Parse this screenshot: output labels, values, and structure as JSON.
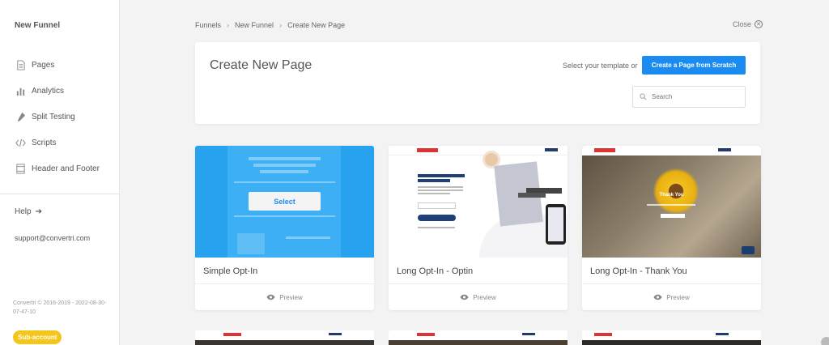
{
  "sidebar": {
    "title": "New Funnel",
    "items": [
      {
        "label": "Pages",
        "icon": "page-icon"
      },
      {
        "label": "Analytics",
        "icon": "bar-chart-icon"
      },
      {
        "label": "Split Testing",
        "icon": "flask-icon"
      },
      {
        "label": "Scripts",
        "icon": "code-icon"
      },
      {
        "label": "Header and Footer",
        "icon": "layout-icon"
      }
    ],
    "help": {
      "label": "Help",
      "icon": "arrow-right-icon"
    },
    "support_email": "support@convertri.com",
    "copyright": "Convertri © 2016-2019 - 2022-08-30-07-47-10",
    "badge": "Sub-account"
  },
  "breadcrumb": [
    "Funnels",
    "New Funnel",
    "Create New Page"
  ],
  "close": {
    "label": "Close",
    "icon": "close-circle-icon"
  },
  "header": {
    "title": "Create New Page",
    "hint": "Select your template or",
    "scratch_button": "Create a Page from Scratch",
    "search_placeholder": "Search"
  },
  "templates": [
    {
      "name": "Simple Opt-In",
      "preview_label": "Preview",
      "select_label": "Select"
    },
    {
      "name": "Long Opt-In - Optin",
      "preview_label": "Preview"
    },
    {
      "name": "Long Opt-In - Thank You",
      "preview_label": "Preview",
      "thumb_text": "Thank You"
    }
  ],
  "colors": {
    "accent": "#1a8bf0",
    "badge": "#f4c51a",
    "background": "#f3f3f4"
  }
}
